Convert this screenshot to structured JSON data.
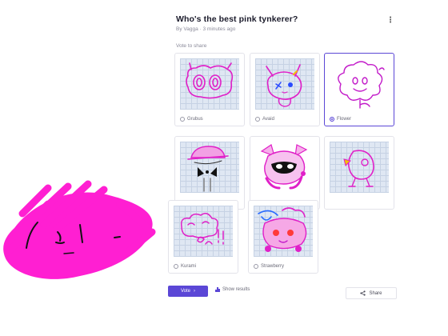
{
  "poll": {
    "title": "Who's the best pink tynkerer?",
    "byline": "By Vagga · 3 minutes ago",
    "menu_icon": "kebab-menu-icon",
    "hint": "Vote to share",
    "options": [
      {
        "label": "Grubus",
        "selected": false
      },
      {
        "label": "Avaid",
        "selected": false
      },
      {
        "label": "Flower",
        "selected": true
      },
      {
        "label": "",
        "selected": false
      },
      {
        "label": "",
        "selected": false
      },
      {
        "label": "",
        "selected": false
      },
      {
        "label": "Kurami",
        "selected": false
      },
      {
        "label": "Strawberry",
        "selected": false
      }
    ],
    "vote_label": "Vote",
    "vote_icon": "arrow-right-icon",
    "results_label": "Show results",
    "results_icon": "bar-chart-icon",
    "share_label": "Share",
    "share_icon": "share-icon"
  },
  "colors": {
    "accent": "#5b47d6",
    "pink": "#ff1fd2",
    "grid_bg": "#dfe7f3"
  }
}
